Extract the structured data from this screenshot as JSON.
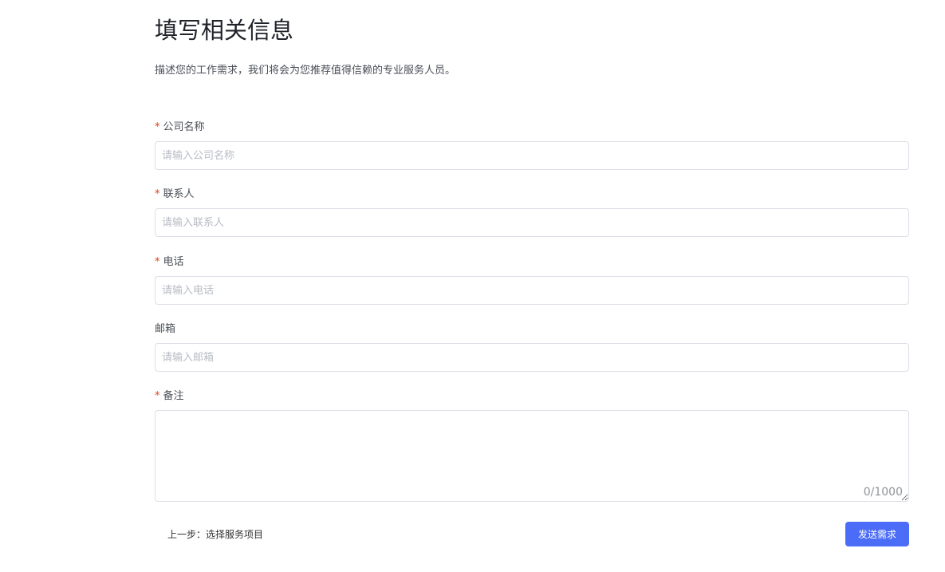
{
  "header": {
    "title": "填写相关信息",
    "description": "描述您的工作需求，我们将会为您推荐值得信赖的专业服务人员。"
  },
  "form": {
    "required_mark": "*",
    "company": {
      "label": "公司名称",
      "placeholder": "请输入公司名称",
      "value": ""
    },
    "contact": {
      "label": "联系人",
      "placeholder": "请输入联系人",
      "value": ""
    },
    "phone": {
      "label": "电话",
      "placeholder": "请输入电话",
      "value": ""
    },
    "email": {
      "label": "邮箱",
      "placeholder": "请输入邮箱",
      "value": ""
    },
    "remark": {
      "label": "备注",
      "value": "",
      "char_count": "0/1000"
    }
  },
  "footer": {
    "prev_label": "上一步：选择服务项目",
    "submit_label": "发送需求"
  },
  "colors": {
    "accent": "#4b6cf7",
    "required": "#e0431f",
    "border": "#dcdfe6"
  }
}
